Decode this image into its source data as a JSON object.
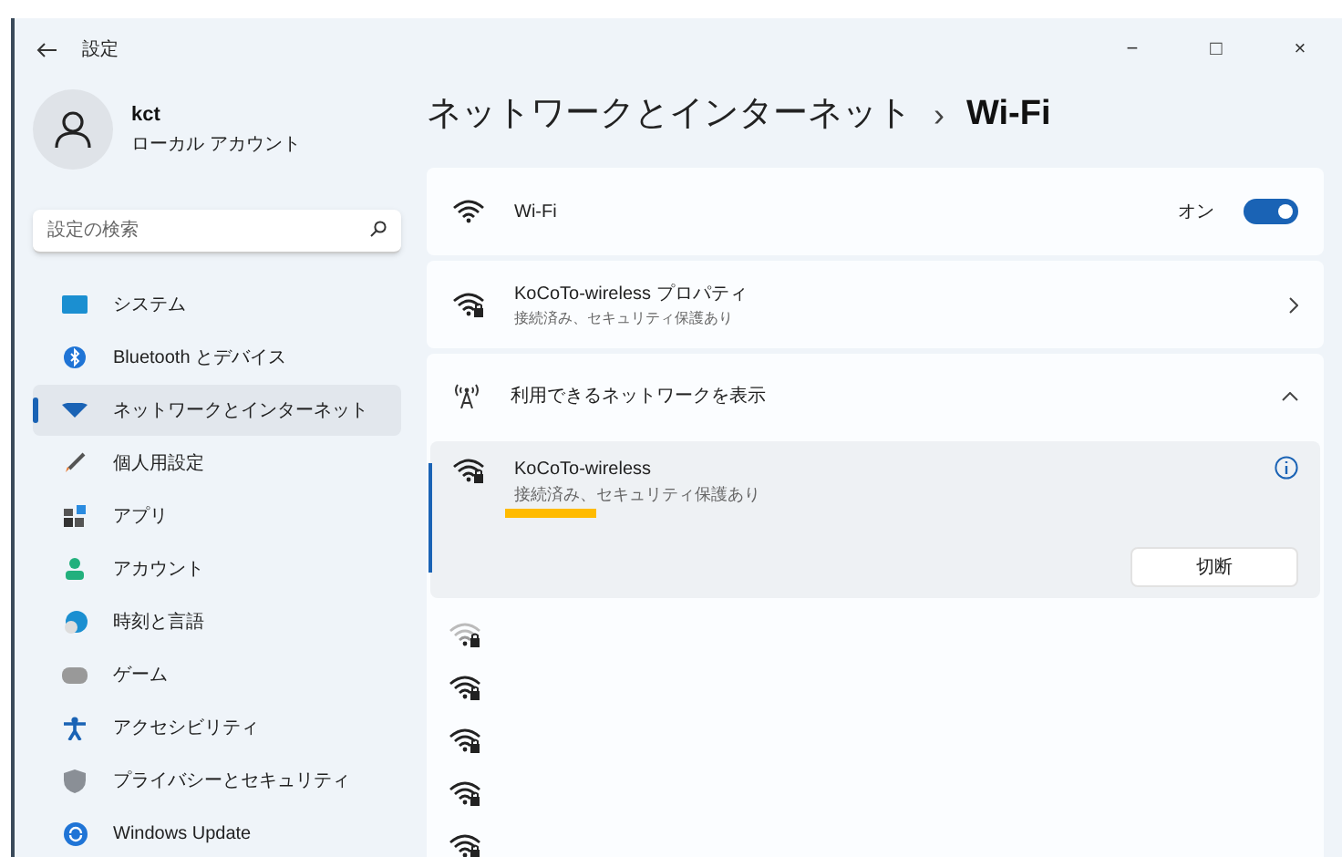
{
  "window": {
    "title": "設定",
    "controls": [
      "−",
      "□",
      "×"
    ]
  },
  "account": {
    "name": "kct",
    "type": "ローカル アカウント"
  },
  "search": {
    "placeholder": "設定の検索"
  },
  "sidebar": {
    "items": [
      {
        "label": "システム",
        "selected": false
      },
      {
        "label": "Bluetooth とデバイス",
        "selected": false
      },
      {
        "label": "ネットワークとインターネット",
        "selected": true
      },
      {
        "label": "個人用設定",
        "selected": false
      },
      {
        "label": "アプリ",
        "selected": false
      },
      {
        "label": "アカウント",
        "selected": false
      },
      {
        "label": "時刻と言語",
        "selected": false
      },
      {
        "label": "ゲーム",
        "selected": false
      },
      {
        "label": "アクセシビリティ",
        "selected": false
      },
      {
        "label": "プライバシーとセキュリティ",
        "selected": false
      },
      {
        "label": "Windows Update",
        "selected": false
      }
    ]
  },
  "breadcrumb": {
    "parent": "ネットワークとインターネット",
    "separator": "›",
    "current": "Wi-Fi"
  },
  "wifi_card": {
    "label": "Wi-Fi",
    "state_label": "オン",
    "on": true
  },
  "properties_card": {
    "title": "KoCoTo-wireless プロパティ",
    "subtitle": "接続済み、セキュリティ保護あり"
  },
  "available_card": {
    "label": "利用できるネットワークを表示",
    "expanded": true
  },
  "connected_network": {
    "name": "KoCoTo-wireless",
    "status": "接続済み、セキュリティ保護あり",
    "highlighted": true,
    "button": "切断"
  },
  "other_networks": [
    {
      "weak": true
    },
    {
      "weak": false
    },
    {
      "weak": false
    },
    {
      "weak": false
    },
    {
      "weak": false
    }
  ]
}
